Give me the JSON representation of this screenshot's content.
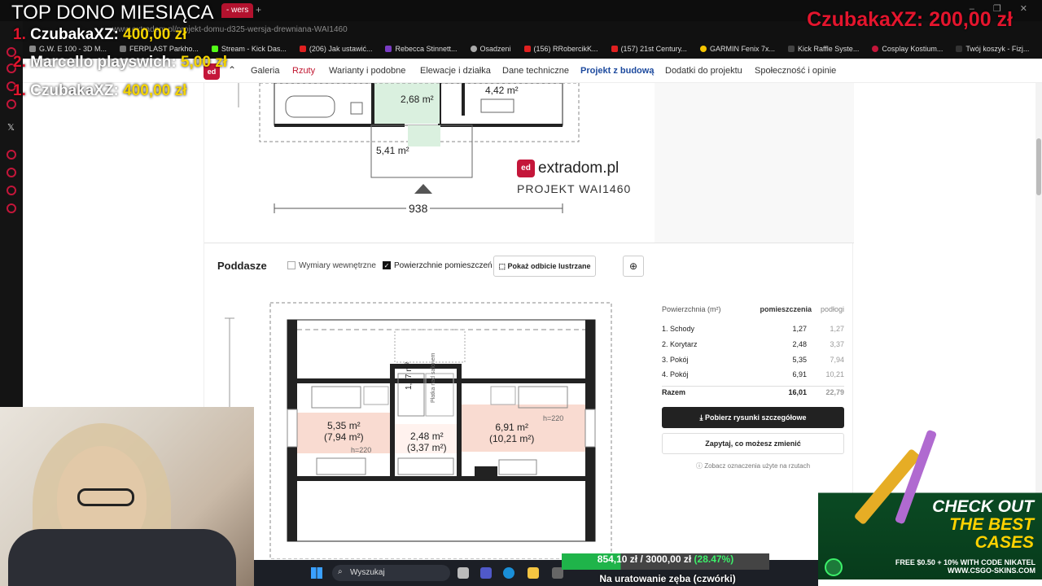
{
  "stream_overlay": {
    "title": "TOP DONO MIESIĄCA",
    "donors": [
      {
        "rank": "1.",
        "name": "CzubakaXZ:",
        "amount": "400,00 zł"
      },
      {
        "rank": "2.",
        "name": "Marcello playswich:",
        "amount": "5,00 zł"
      },
      {
        "rank": "1.",
        "name": "CzubakaXZ:",
        "amount": "400,00 zł"
      }
    ],
    "top_right_name": "CzubakaXZ:",
    "top_right_amount": "200,00 zł",
    "goal_progress": "854,10 zł / 3000,00 zł",
    "goal_percent": "(28.47%)",
    "goal_fraction": 0.2847,
    "goal_caption": "Na uratowanie zęba (czwórki)"
  },
  "browser": {
    "tab_label": "- wers",
    "url": "www.extradom.pl/projekt-domu-d325-wersja-drewniana-WAI1460",
    "bookmarks": [
      "G.W. E 100 - 3D M...",
      "FERPLAST Parkho...",
      "Stream - Kick Das...",
      "(206) Jak ustawić...",
      "Rebecca Stinnett...",
      "Osadzeni",
      "(156) RRobercikK...",
      "(157) 21st Century...",
      "GARMIN Fenix 7x...",
      "Kick Raffle Syste...",
      "Cosplay Kostium...",
      "Twój koszyk - Fizj..."
    ]
  },
  "site_nav": {
    "items": [
      "Galeria",
      "Rzuty",
      "Warianty i podobne",
      "Elewacje i działka",
      "Dane techniczne",
      "Projekt z budową",
      "Dodatki do projektu",
      "Społeczność i opinie"
    ]
  },
  "plan_top": {
    "rooms": [
      "2,68 m²",
      "4,42 m²",
      "5,41 m²"
    ],
    "dimension": "938",
    "brand": "extradom.pl",
    "project": "PROJEKT WAI1460"
  },
  "attic": {
    "title": "Poddasze",
    "checkbox_inner": "Wymiary wewnętrzne",
    "checkbox_areas": "Powierzchnie pomieszczeń",
    "mirror_button": "Pokaż odbicie lustrzane",
    "rooms": [
      {
        "a": "5,35 m²",
        "b": "(7,94 m²)"
      },
      {
        "a": "2,48 m²",
        "b": "(3,37 m²)"
      },
      {
        "a": "6,91 m²",
        "b": "(10,21 m²)"
      }
    ],
    "stair_area": "1,27 m²",
    "attic_label": "Płatka nad salonem",
    "h_left": "h=220",
    "h_right": "h=220"
  },
  "area_table": {
    "header": "Powierzchnia (m²)",
    "col1": "pomieszczenia",
    "col2": "podłogi",
    "rows": [
      {
        "name": "1. Schody",
        "v1": "1,27",
        "v2": "1,27"
      },
      {
        "name": "2. Korytarz",
        "v1": "2,48",
        "v2": "3,37"
      },
      {
        "name": "3. Pokój",
        "v1": "5,35",
        "v2": "7,94"
      },
      {
        "name": "4. Pokój",
        "v1": "6,91",
        "v2": "10,21"
      }
    ],
    "total_label": "Razem",
    "total_v1": "16,01",
    "total_v2": "22,79",
    "download_button": "Pobierz rysunki szczegółowe",
    "ask_button": "Zapytaj, co możesz zmienić",
    "note": "Zobacz oznaczenia użyte na rzutach"
  },
  "ad": {
    "line1": "CHECK OUT",
    "line2": "THE BEST",
    "line3": "CASES",
    "promo": "FREE $0.50 + 10% WITH CODE NIKATEL",
    "site": "WWW.CSGO-SKINS.COM"
  },
  "taskbar": {
    "search_placeholder": "Wyszukaj"
  }
}
